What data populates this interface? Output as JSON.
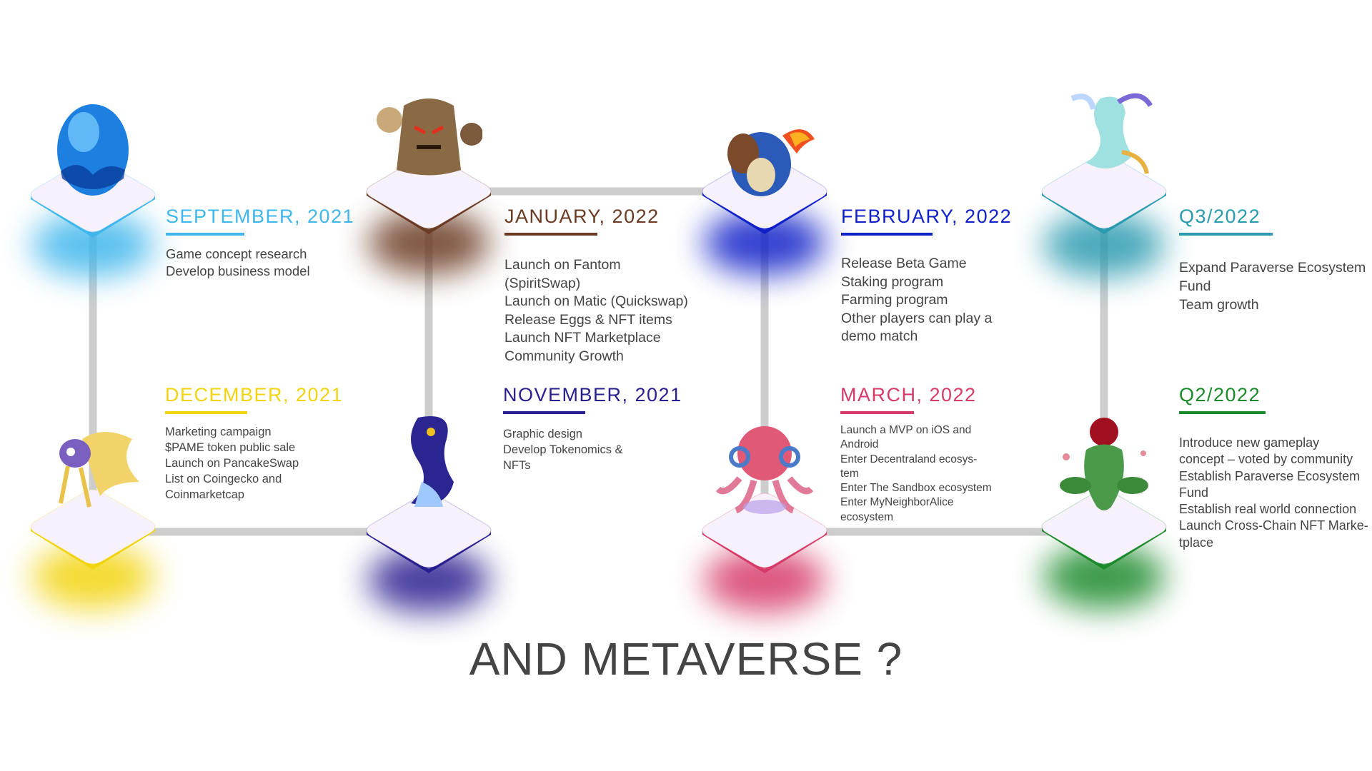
{
  "footer": {
    "title": "AND METAVERSE ?"
  },
  "milestones": [
    {
      "id": "sep2021",
      "title": "SEPTEMBER, 2021",
      "color": "#3fb6ec",
      "creature": "blue-egg-icon",
      "items": [
        "Game concept research",
        "Develop business model"
      ]
    },
    {
      "id": "dec2021",
      "title": "DECEMBER, 2021",
      "color": "#f2d40e",
      "creature": "yellow-fox-creature-icon",
      "items": [
        "Marketing campaign",
        "$PAME token public sale",
        "Launch on PancakeSwap",
        "List on Coingecko and",
        "Coinmarketcap"
      ]
    },
    {
      "id": "jan2022",
      "title": "JANUARY, 2022",
      "color": "#6b3a22",
      "creature": "rock-golem-creature-icon",
      "items": [
        "Launch on Fantom",
        "(SpiritSwap)",
        "Launch on Matic (Quickswap)",
        "Release Eggs & NFT items",
        "Launch NFT Marketplace",
        "Community Growth"
      ]
    },
    {
      "id": "nov2021",
      "title": "NOVEMBER, 2021",
      "color": "#2a1f8f",
      "creature": "purple-serpent-creature-icon",
      "items": [
        "Graphic design",
        "Develop Tokenomics &",
        "NFTs"
      ]
    },
    {
      "id": "feb2022",
      "title": "FEBRUARY, 2022",
      "color": "#1020c8",
      "creature": "fire-turtle-creature-icon",
      "items": [
        "Release Beta Game",
        "Staking program",
        "Farming program",
        "Other players can play a",
        "demo match"
      ]
    },
    {
      "id": "mar2022",
      "title": "MARCH, 2022",
      "color": "#d63a68",
      "creature": "pink-octopus-creature-icon",
      "items": [
        "Launch a MVP on iOS and",
        "Android",
        "Enter Decentraland ecosys-",
        "tem",
        "Enter The Sandbox ecosystem",
        "Enter MyNeighborAlice",
        "ecosystem"
      ]
    },
    {
      "id": "q3-2022",
      "title": "Q3/2022",
      "color": "#2a9ab0",
      "creature": "water-mermaid-creature-icon",
      "items": [
        "Expand Paraverse Ecosystem",
        "Fund",
        "Team growth"
      ]
    },
    {
      "id": "q2-2022",
      "title": "Q2/2022",
      "color": "#1a8a2a",
      "creature": "rose-plant-creature-icon",
      "items": [
        "Introduce new gameplay",
        "concept – voted by community",
        "Establish Paraverse Ecosystem",
        "Fund",
        "Establish real world connection",
        "Launch Cross-Chain NFT Marke-",
        "tplace"
      ]
    }
  ]
}
